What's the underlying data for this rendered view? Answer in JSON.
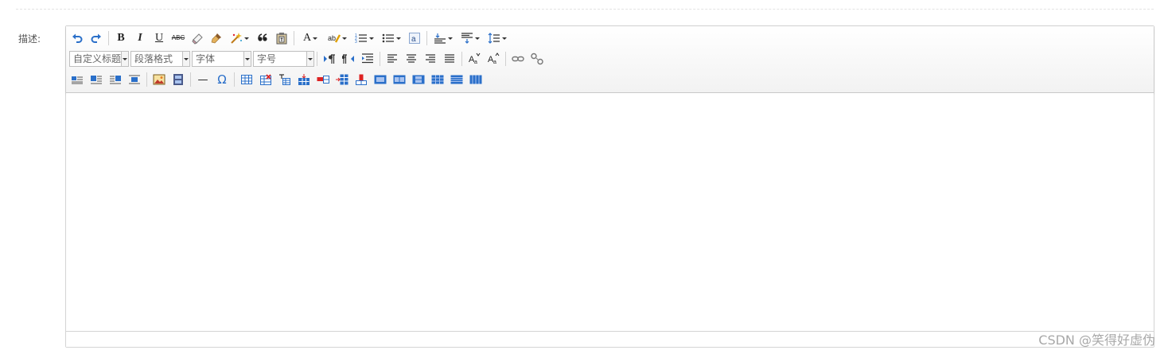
{
  "form": {
    "label": "描述:"
  },
  "toolbar": {
    "bold": "B",
    "italic": "I",
    "underline": "U",
    "strikethrough": "ABC",
    "fontcolor": "A",
    "customstyle": "自定义标题",
    "paragraph": "段落格式",
    "fontfamily": "字体",
    "fontsize": "字号",
    "horizontal": "—",
    "special_chars": "Ω"
  },
  "colors": {
    "accent": "#2a6fc9",
    "toolbar_bg": "#f2f2f2",
    "border": "#d4d4d4"
  },
  "watermark": "CSDN @笑得好虚伪"
}
